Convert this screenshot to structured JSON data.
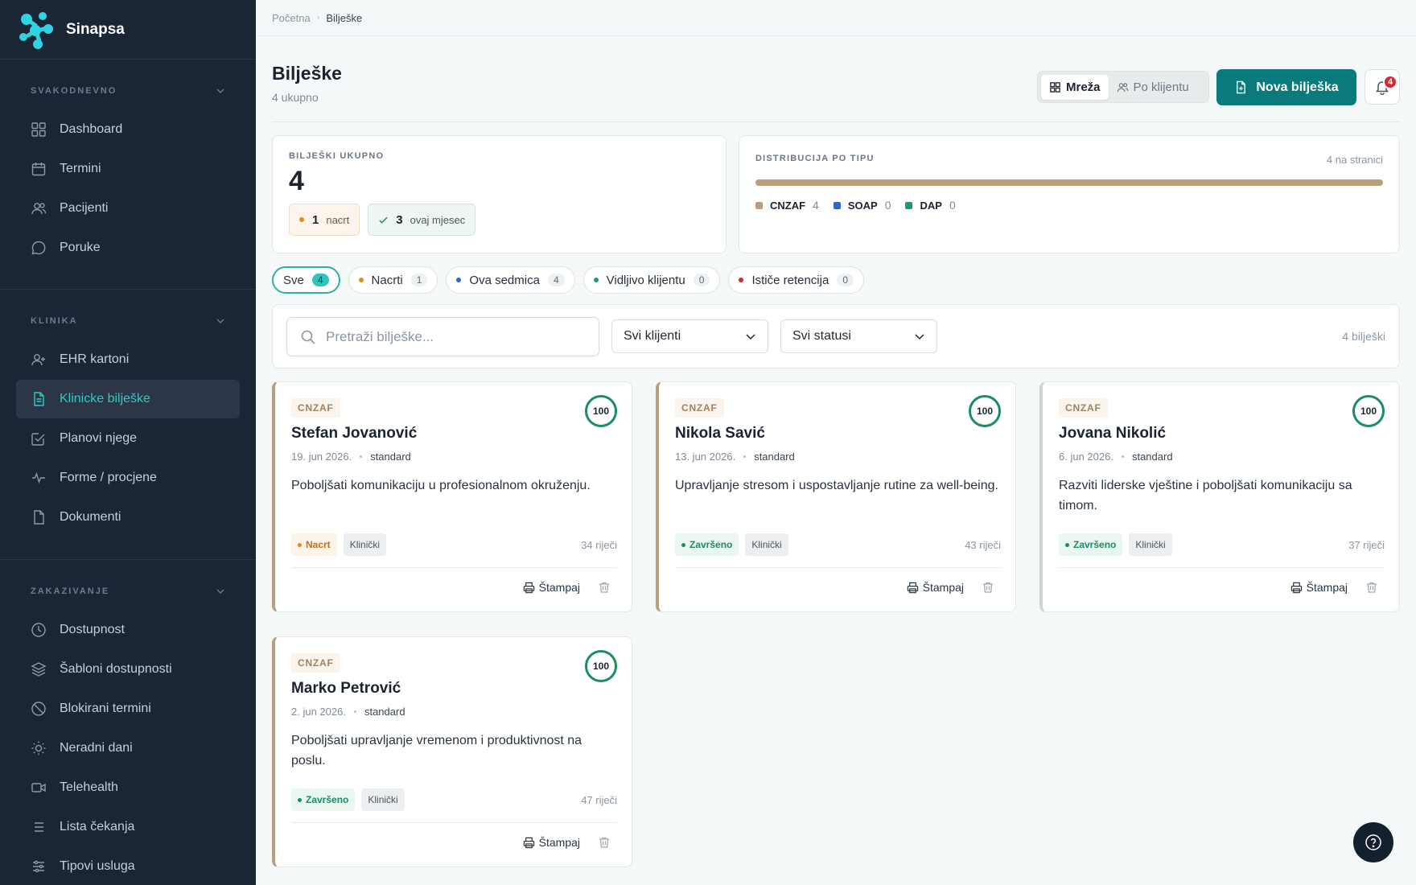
{
  "brand": {
    "name": "Sinapsa"
  },
  "sidebar": {
    "sections": [
      {
        "title": "SVAKODNEVNO",
        "items": [
          {
            "label": "Dashboard",
            "icon": "grid-icon"
          },
          {
            "label": "Termini",
            "icon": "calendar-icon"
          },
          {
            "label": "Pacijenti",
            "icon": "users-icon"
          },
          {
            "label": "Poruke",
            "icon": "chat-icon"
          }
        ]
      },
      {
        "title": "KLINIKA",
        "items": [
          {
            "label": "EHR kartoni",
            "icon": "user-plus-icon"
          },
          {
            "label": "Klinicke bilješke",
            "icon": "document-icon",
            "active": true
          },
          {
            "label": "Planovi njege",
            "icon": "checklist-icon"
          },
          {
            "label": "Forme / procjene",
            "icon": "activity-icon"
          },
          {
            "label": "Dokumenti",
            "icon": "file-icon"
          }
        ]
      },
      {
        "title": "ZAKAZIVANJE",
        "items": [
          {
            "label": "Dostupnost",
            "icon": "clock-icon"
          },
          {
            "label": "Šabloni dostupnosti",
            "icon": "layers-icon"
          },
          {
            "label": "Blokirani termini",
            "icon": "ban-icon"
          },
          {
            "label": "Neradni dani",
            "icon": "sun-icon"
          },
          {
            "label": "Telehealth",
            "icon": "video-icon"
          },
          {
            "label": "Lista čekanja",
            "icon": "list-icon"
          },
          {
            "label": "Tipovi usluga",
            "icon": "sliders-icon"
          }
        ]
      }
    ]
  },
  "breadcrumb": {
    "home": "Početna",
    "separator": "›",
    "current": "Bilješke"
  },
  "page": {
    "title": "Bilješke",
    "subtitle": "4 ukupno"
  },
  "view_toggle": {
    "grid": "Mreža",
    "by_client": "Po klijentu"
  },
  "new_note_button": "Nova bilješka",
  "notifications": {
    "count": "4"
  },
  "stats": {
    "total_label": "BILJEŠKI UKUPNO",
    "total": "4",
    "draft_count": "1",
    "draft_label": "nacrt",
    "month_count": "3",
    "month_label": "ovaj mjesec"
  },
  "distribution": {
    "label": "DISTRIBUCIJA PO TIPU",
    "per_page": "4 na stranici",
    "fill_fraction": 1.0,
    "items": [
      {
        "name": "CNZAF",
        "count": "4",
        "color": "#b99f7c"
      },
      {
        "name": "SOAP",
        "count": "0",
        "color": "#2f63d6"
      },
      {
        "name": "DAP",
        "count": "0",
        "color": "#1a9b6c"
      }
    ]
  },
  "filters": [
    {
      "label": "Sve",
      "count": "4",
      "active": true
    },
    {
      "label": "Nacrti",
      "count": "1",
      "dot": "#e08a25"
    },
    {
      "label": "Ova sedmica",
      "count": "4",
      "dot": "#2f63d6"
    },
    {
      "label": "Vidljivo klijentu",
      "count": "0",
      "dot": "#1a9b6c"
    },
    {
      "label": "Ističe retencija",
      "count": "0",
      "dot": "#d8262e"
    }
  ],
  "search": {
    "placeholder": "Pretraži bilješke...",
    "client_select": "Svi klijenti",
    "status_select": "Svi statusi",
    "result_count": "4 bilješki"
  },
  "notes": [
    {
      "type": "CNZAF",
      "score": "100",
      "client": "Stefan Jovanović",
      "date": "19. jun 2026.",
      "plan": "standard",
      "goal": "Poboljšati komunikaciju u profesionalnom okruženju.",
      "status": "Nacrt",
      "category": "Klinički",
      "words": "34 riječi",
      "print": "Štampaj"
    },
    {
      "type": "CNZAF",
      "score": "100",
      "client": "Nikola Savić",
      "date": "13. jun 2026.",
      "plan": "standard",
      "goal": "Upravljanje stresom i uspostavljanje rutine za well-being.",
      "status": "Završeno",
      "category": "Klinički",
      "words": "43 riječi",
      "print": "Štampaj"
    },
    {
      "type": "CNZAF",
      "score": "100",
      "client": "Jovana Nikolić",
      "date": "6. jun 2026.",
      "plan": "standard",
      "goal": "Razviti liderske vještine i poboljšati komunikaciju sa timom.",
      "status": "Završeno",
      "category": "Klinički",
      "words": "37 riječi",
      "print": "Štampaj"
    },
    {
      "type": "CNZAF",
      "score": "100",
      "client": "Marko Petrović",
      "date": "2. jun 2026.",
      "plan": "standard",
      "goal": "Poboljšati upravljanje vremenom i produktivnost na poslu.",
      "status": "Završeno",
      "category": "Klinički",
      "words": "47 riječi",
      "print": "Štampaj"
    }
  ],
  "colors": {
    "accent": "#0b7a7d",
    "sidebar": "#1a2535",
    "active_nav": "#32c9c3",
    "done": "#1a8d63",
    "draft": "#e08a25"
  }
}
